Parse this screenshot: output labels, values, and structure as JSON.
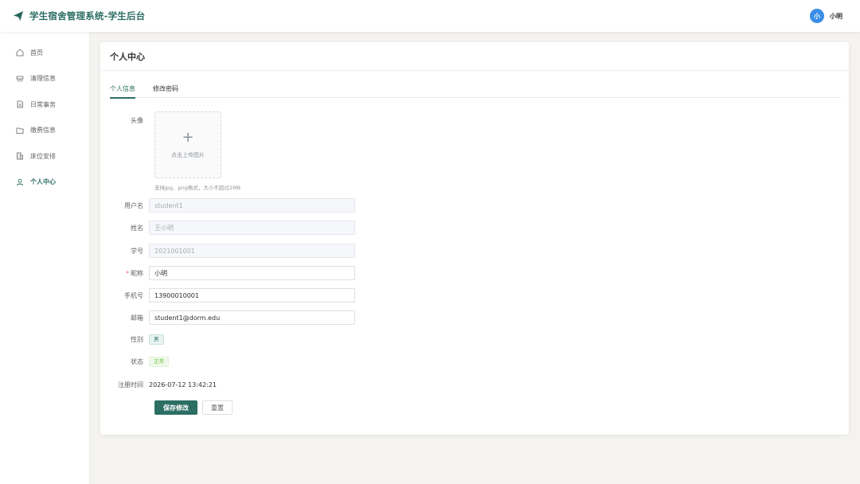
{
  "header": {
    "brand_icon": "paper-plane-icon",
    "title": "学生宿舍管理系统-学生后台",
    "user_avatar_letter": "小",
    "user_name": "小明",
    "accent_color": "#2c6e63",
    "avatar_color": "#3a8ee6"
  },
  "sidebar": {
    "items": [
      {
        "label": "首页",
        "icon": "home-icon"
      },
      {
        "label": "清理信息",
        "icon": "broom-icon"
      },
      {
        "label": "日常事务",
        "icon": "document-icon"
      },
      {
        "label": "缴费信息",
        "icon": "folder-icon"
      },
      {
        "label": "床位安排",
        "icon": "building-icon"
      },
      {
        "label": "个人中心",
        "icon": "user-icon",
        "active": true
      }
    ]
  },
  "card": {
    "title": "个人中心"
  },
  "tabs": [
    {
      "label": "个人信息",
      "active": true
    },
    {
      "label": "修改密码",
      "active": false
    }
  ],
  "form": {
    "avatar_label": "头像",
    "upload_text": "点击上传图片",
    "upload_hint": "支持jpg、png格式，大小不超过2MB",
    "username_label": "用户名",
    "username_value": "student1",
    "name_label": "姓名",
    "name_value": "王小明",
    "student_no_label": "学号",
    "student_no_value": "2021001001",
    "required_mark": "*",
    "nickname_label": "昵称",
    "nickname_value": "小明",
    "phone_label": "手机号",
    "phone_value": "13900010001",
    "email_label": "邮箱",
    "email_value": "student1@dorm.edu",
    "gender_label": "性别",
    "gender_value": "男",
    "status_label": "状态",
    "status_value": "正常",
    "register_label": "注册时间",
    "register_value": "2026-07-12 13:42:21",
    "save_button": "保存修改",
    "reset_button": "重置"
  }
}
